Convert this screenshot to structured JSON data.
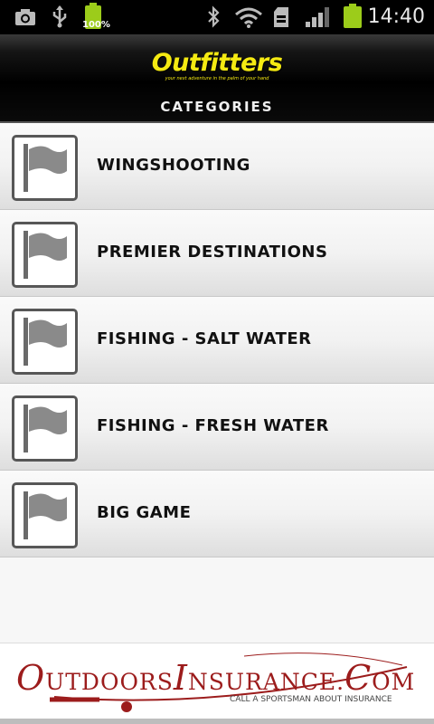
{
  "status_bar": {
    "battery_percent": "100%",
    "time": "14:40",
    "icons": [
      "camera-icon",
      "usb-icon",
      "battery-icon",
      "bluetooth-icon",
      "wifi-icon",
      "sd-card-icon",
      "signal-icon",
      "battery-icon"
    ]
  },
  "header": {
    "logo_text": "Outfitters",
    "logo_tagline": "your next adventure in the palm of your hand",
    "title": "CATEGORIES"
  },
  "categories": [
    {
      "label": "WINGSHOOTING",
      "icon": "flag-icon"
    },
    {
      "label": "PREMIER DESTINATIONS",
      "icon": "flag-icon"
    },
    {
      "label": "FISHING - SALT WATER",
      "icon": "flag-icon"
    },
    {
      "label": "FISHING - FRESH WATER",
      "icon": "flag-icon"
    },
    {
      "label": "BIG GAME",
      "icon": "flag-icon"
    }
  ],
  "ad": {
    "brand_o": "O",
    "brand_mid": "UTDOORS",
    "brand_i": "I",
    "brand_rest": "NSURANCE",
    "brand_dot": ".",
    "brand_c": "C",
    "brand_om": "OM",
    "tagline": "CALL A SPORTSMAN ABOUT INSURANCE"
  },
  "colors": {
    "logo_yellow": "#f5ea12",
    "ad_red": "#9c1c1c",
    "battery_green": "#9ccc1a"
  }
}
